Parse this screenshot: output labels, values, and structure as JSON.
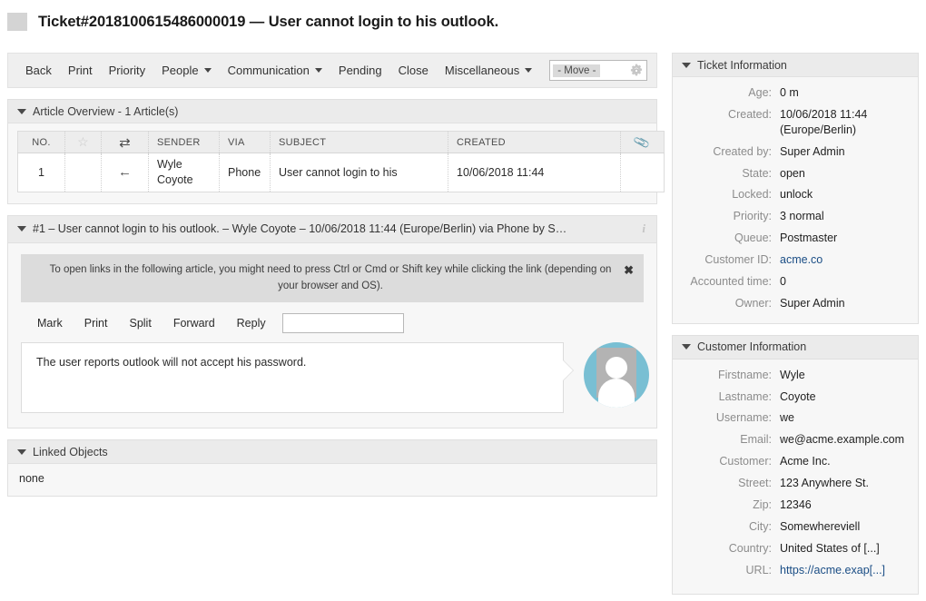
{
  "header": {
    "icon": "square-placeholder-icon",
    "title": "Ticket#2018100615486000019 — User cannot login to his outlook."
  },
  "toolbar": {
    "items": [
      {
        "label": "Back",
        "caret": false
      },
      {
        "label": "Print",
        "caret": false
      },
      {
        "label": "Priority",
        "caret": false
      },
      {
        "label": "People",
        "caret": true
      },
      {
        "label": "Communication",
        "caret": true
      },
      {
        "label": "Pending",
        "caret": false
      },
      {
        "label": "Close",
        "caret": false
      },
      {
        "label": "Miscellaneous",
        "caret": true
      }
    ],
    "move_chip": "- Move -",
    "gear_icon": "gear-icon"
  },
  "article_overview": {
    "title": "Article Overview - 1 Article(s)",
    "columns": [
      "NO.",
      "star-icon",
      "swap-icon",
      "SENDER",
      "VIA",
      "SUBJECT",
      "CREATED",
      "paperclip-icon"
    ],
    "column_labels": {
      "no": "NO.",
      "sender": "SENDER",
      "via": "VIA",
      "subject": "SUBJECT",
      "created": "CREATED"
    },
    "rows": [
      {
        "no": "1",
        "star": "",
        "direction": "←",
        "sender": "Wyle Coyote",
        "via": "Phone",
        "subject": "User cannot login to his",
        "created": "10/06/2018 11:44",
        "attachment": ""
      }
    ]
  },
  "article": {
    "title": "#1 – User cannot login to his outlook. – Wyle Coyote – 10/06/2018 11:44 (Europe/Berlin) via Phone by S…",
    "info_icon": "info-icon",
    "notice": "To open links in the following article, you might need to press Ctrl or Cmd or Shift key while clicking the link (depending on your browser and OS).",
    "notice_close": "✖",
    "actions": [
      "Mark",
      "Print",
      "Split",
      "Forward",
      "Reply"
    ],
    "reply_value": "",
    "reply_placeholder": "",
    "body": "The user reports outlook will not accept his password.",
    "avatar": "user-avatar"
  },
  "linked_objects": {
    "title": "Linked Objects",
    "content": "none"
  },
  "ticket_information": {
    "title": "Ticket Information",
    "rows": [
      {
        "label": "Age:",
        "value": "0 m",
        "link": false
      },
      {
        "label": "Created:",
        "value": "10/06/2018 11:44 (Europe/Berlin)",
        "link": false
      },
      {
        "label": "Created by:",
        "value": "Super Admin",
        "link": false
      },
      {
        "label": "State:",
        "value": "open",
        "link": false
      },
      {
        "label": "Locked:",
        "value": "unlock",
        "link": false
      },
      {
        "label": "Priority:",
        "value": "3 normal",
        "link": false
      },
      {
        "label": "Queue:",
        "value": "Postmaster",
        "link": false
      },
      {
        "label": "Customer ID:",
        "value": "acme.co",
        "link": true
      },
      {
        "label": "Accounted time:",
        "value": "0",
        "link": false
      },
      {
        "label": "Owner:",
        "value": "Super Admin",
        "link": false
      }
    ]
  },
  "customer_information": {
    "title": "Customer Information",
    "rows": [
      {
        "label": "Firstname:",
        "value": "Wyle",
        "link": false
      },
      {
        "label": "Lastname:",
        "value": "Coyote",
        "link": false
      },
      {
        "label": "Username:",
        "value": "we",
        "link": false
      },
      {
        "label": "Email:",
        "value": "we@acme.example.com",
        "link": false
      },
      {
        "label": "Customer:",
        "value": "Acme Inc.",
        "link": false
      },
      {
        "label": "Street:",
        "value": "123 Anywhere St.",
        "link": false
      },
      {
        "label": "Zip:",
        "value": "12346",
        "link": false
      },
      {
        "label": "City:",
        "value": "Somewhereviell",
        "link": false
      },
      {
        "label": "Country:",
        "value": "United States of [...]",
        "link": false
      },
      {
        "label": "URL:",
        "value": "https://acme.exap[...]",
        "link": true
      }
    ]
  },
  "colors": {
    "accent": "#79bfd3",
    "link": "#1a4d85",
    "panel_header": "#ebebeb",
    "panel_body": "#f7f7f7",
    "toolbar": "#efefef"
  }
}
